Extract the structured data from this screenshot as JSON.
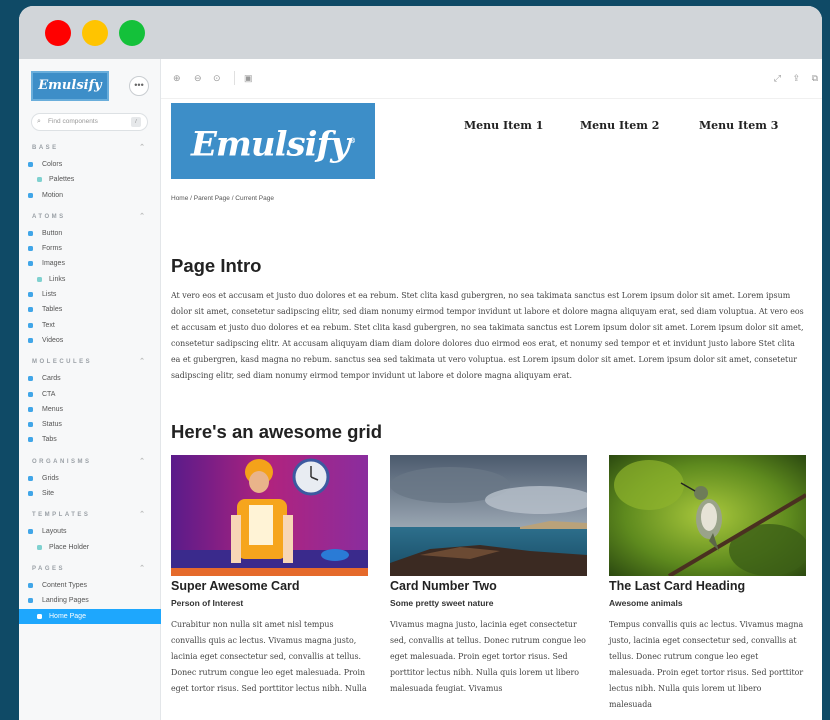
{
  "window": {
    "controls": [
      "close",
      "minimize",
      "maximize"
    ]
  },
  "sidebar": {
    "logo_text": "Emulsify",
    "menu_icon": "ellipsis-icon",
    "search_placeholder": "Find components",
    "search_shortcut": "/",
    "sections": [
      {
        "title": "BASE",
        "items": [
          {
            "label": "Colors",
            "child": false,
            "active": false
          },
          {
            "label": "Palettes",
            "child": true,
            "active": false
          },
          {
            "label": "Motion",
            "child": false,
            "active": false
          }
        ]
      },
      {
        "title": "ATOMS",
        "items": [
          {
            "label": "Button",
            "child": false,
            "active": false
          },
          {
            "label": "Forms",
            "child": false,
            "active": false
          },
          {
            "label": "Images",
            "child": false,
            "active": false
          },
          {
            "label": "Links",
            "child": true,
            "active": false
          },
          {
            "label": "Lists",
            "child": false,
            "active": false
          },
          {
            "label": "Tables",
            "child": false,
            "active": false
          },
          {
            "label": "Text",
            "child": false,
            "active": false
          },
          {
            "label": "Videos",
            "child": false,
            "active": false
          }
        ]
      },
      {
        "title": "MOLECULES",
        "items": [
          {
            "label": "Cards",
            "child": false,
            "active": false
          },
          {
            "label": "CTA",
            "child": false,
            "active": false
          },
          {
            "label": "Menus",
            "child": false,
            "active": false
          },
          {
            "label": "Status",
            "child": false,
            "active": false
          },
          {
            "label": "Tabs",
            "child": false,
            "active": false
          }
        ]
      },
      {
        "title": "ORGANISMS",
        "items": [
          {
            "label": "Grids",
            "child": false,
            "active": false
          },
          {
            "label": "Site",
            "child": false,
            "active": false
          }
        ]
      },
      {
        "title": "TEMPLATES",
        "items": [
          {
            "label": "Layouts",
            "child": false,
            "active": false
          },
          {
            "label": "Place Holder",
            "child": true,
            "active": false
          }
        ]
      },
      {
        "title": "PAGES",
        "items": [
          {
            "label": "Content Types",
            "child": false,
            "active": false
          },
          {
            "label": "Landing Pages",
            "child": false,
            "active": false
          },
          {
            "label": "Home Page",
            "child": true,
            "active": true
          }
        ]
      }
    ]
  },
  "toolbar": {
    "left_icons": [
      "zoom-in-icon",
      "zoom-out-icon",
      "zoom-reset-icon",
      "background-icon"
    ],
    "right_icons": [
      "fullscreen-icon",
      "share-icon",
      "open-new-icon"
    ]
  },
  "page": {
    "brand": "Emulsify",
    "menu": [
      "Menu Item 1",
      "Menu Item 2",
      "Menu Item 3"
    ],
    "breadcrumb": "Home / Parent Page / Current Page",
    "intro_heading": "Page Intro",
    "intro_text": "At vero eos et accusam et justo duo dolores et ea rebum. Stet clita kasd gubergren, no sea takimata sanctus est Lorem ipsum dolor sit amet. Lorem ipsum dolor sit amet, consetetur sadipscing elitr, sed diam nonumy eirmod tempor invidunt ut labore et dolore magna aliquyam erat, sed diam voluptua. At vero eos et accusam et justo duo dolores et ea rebum. Stet clita kasd gubergren, no sea takimata sanctus est Lorem ipsum dolor sit amet. Lorem ipsum dolor sit amet, consetetur sadipscing elitr. At accusam aliquyam diam diam dolore dolores duo eirmod eos erat, et nonumy sed tempor et et invidunt justo labore Stet clita ea et gubergren, kasd magna no rebum. sanctus sea sed takimata ut vero voluptua. est Lorem ipsum dolor sit amet. Lorem ipsum dolor sit amet, consetetur sadipscing elitr, sed diam nonumy eirmod tempor invidunt ut labore et dolore magna aliquyam erat.",
    "grid_heading": "Here's an awesome grid",
    "cards": [
      {
        "title": "Super Awesome Card",
        "subtitle": "Person of Interest",
        "body": "Curabitur non nulla sit amet nisl tempus convallis quis ac lectus. Vivamus magna justo, lacinia eget consectetur sed, convallis at tellus. Donec rutrum congue leo eget malesuada. Proin eget tortor risus. Sed porttitor lectus nibh. Nulla"
      },
      {
        "title": "Card Number Two",
        "subtitle": "Some pretty sweet nature",
        "body": "Vivamus magna justo, lacinia eget consectetur sed, convallis at tellus. Donec rutrum congue leo eget malesuada. Proin eget tortor risus. Sed porttitor lectus nibh. Nulla quis lorem ut libero malesuada feugiat. Vivamus"
      },
      {
        "title": "The Last Card Heading",
        "subtitle": "Awesome animals",
        "body": "Tempus convallis quis ac lectus. Vivamus magna justo, lacinia eget consectetur sed, convallis at tellus. Donec rutrum congue leo eget malesuada. Proin eget tortor risus. Sed porttitor lectus nibh. Nulla quis lorem ut libero malesuada"
      }
    ]
  },
  "colors": {
    "accent": "#1ea7fd",
    "brand": "#3d8ec8",
    "frame": "#0f4a66"
  }
}
